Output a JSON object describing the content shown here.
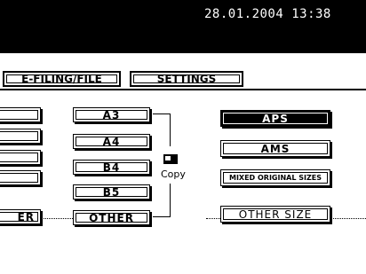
{
  "header": {
    "datetime": "28.01.2004 13:38"
  },
  "tabs": [
    {
      "label": "E-FILING/FILE"
    },
    {
      "label": "SETTINGS"
    }
  ],
  "left_partial_last_label": "ER",
  "paper_sizes": [
    "A3",
    "A4",
    "B4",
    "B5",
    "OTHER"
  ],
  "copy_label": "Copy",
  "mode_buttons": {
    "aps": "APS",
    "ams": "AMS",
    "mixed": "MIXED ORIGINAL SIZES",
    "other_size": "OTHER SIZE"
  },
  "colors": {
    "background": "#000000",
    "selected": "#000000",
    "panel": "#ffffff"
  }
}
